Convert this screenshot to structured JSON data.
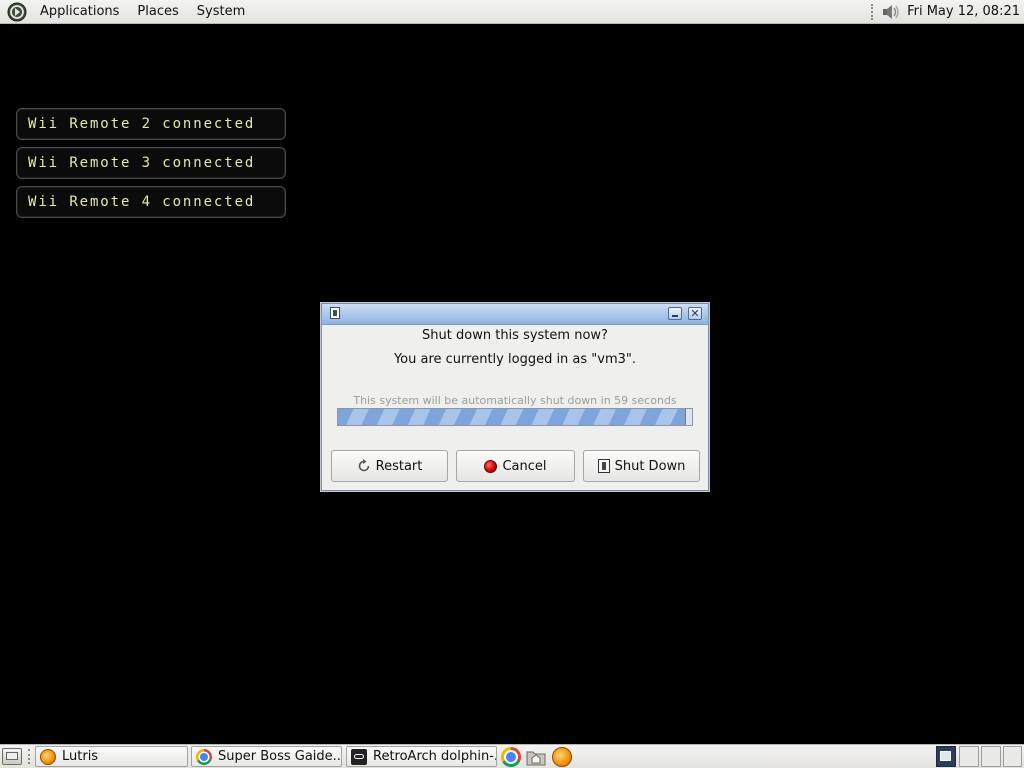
{
  "top_panel": {
    "menus": [
      "Applications",
      "Places",
      "System"
    ],
    "clock": "Fri May 12, 08:21",
    "icons": [
      "gnome-foot-logo-icon",
      "volume-icon"
    ]
  },
  "notifications": [
    "Wii Remote 2 connected",
    "Wii Remote 3 connected",
    "Wii Remote 4 connected"
  ],
  "dialog": {
    "question": "Shut down this system now?",
    "logged_in": "You are currently logged in as \"vm3\".",
    "auto_text": "This system will be automatically shut down in 59 seconds",
    "progress_fraction": 0.98,
    "buttons": {
      "restart": "Restart",
      "cancel": "Cancel",
      "shutdown": "Shut Down"
    }
  },
  "taskbar": {
    "tasks": [
      "Lutris",
      "Super Boss Gaide...",
      "RetroArch dolphin-..."
    ],
    "launchers": [
      "chrome-icon",
      "files-icon",
      "lutris-icon"
    ],
    "workspaces": 4
  }
}
